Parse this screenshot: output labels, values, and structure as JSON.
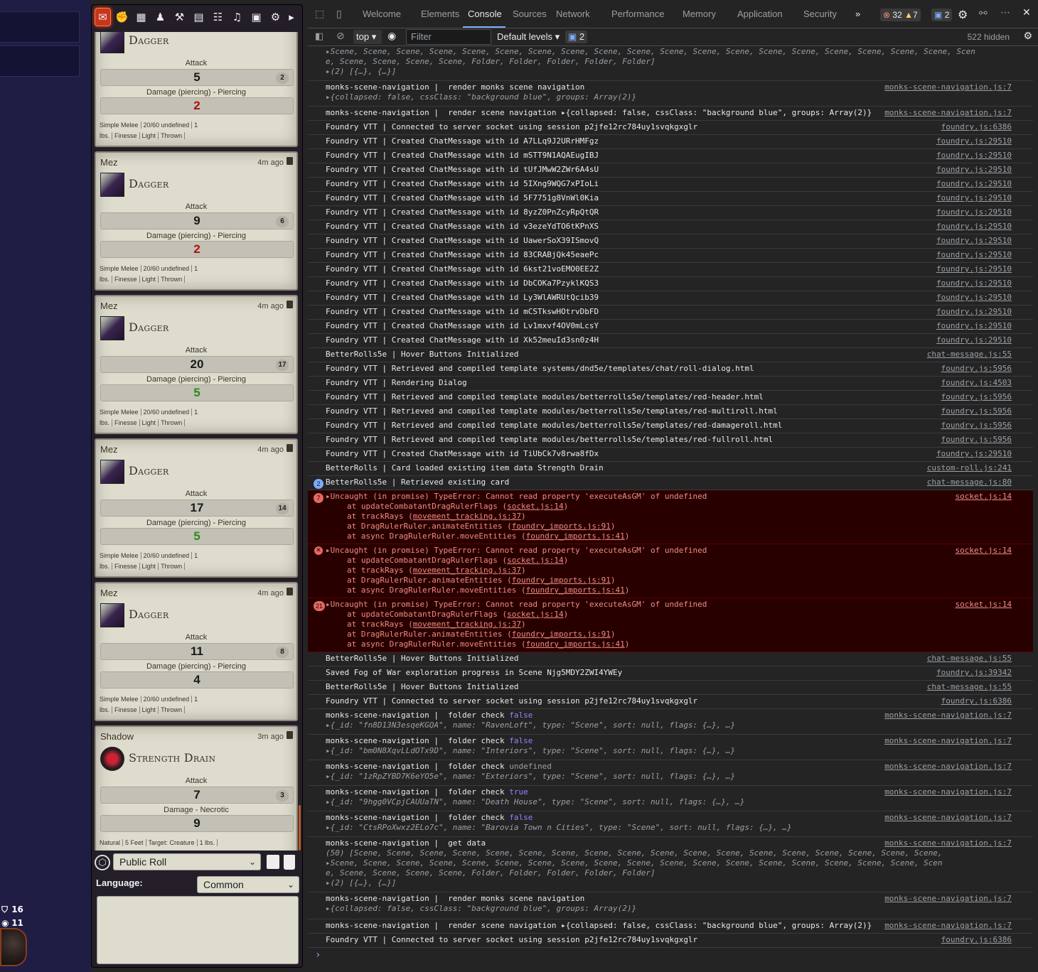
{
  "game": {
    "token_stats": [
      {
        "icon": "shield-icon",
        "value": "16"
      },
      {
        "icon": "eye-icon",
        "value": "11"
      }
    ]
  },
  "sidebar": {
    "tabs": [
      "chat-icon",
      "combat-icon",
      "scenes-icon",
      "actors-icon",
      "items-icon",
      "journal-icon",
      "tables-icon",
      "playlists-icon",
      "compendium-icon",
      "settings-icon",
      "collapse-icon"
    ],
    "cards": [
      {
        "speaker": "",
        "time": "",
        "item": "Dagger",
        "attack_label": "Attack",
        "attack": "5",
        "attack_nat": "2",
        "damage_label": "Damage (piercing) - Piercing",
        "damage": "2",
        "damage_style": "crit-fail",
        "props": [
          "Simple Melee",
          "20/60 undefined",
          "1 lbs.",
          "Finesse",
          "Light",
          "Thrown"
        ]
      },
      {
        "speaker": "Mez",
        "time": "4m ago",
        "item": "Dagger",
        "attack_label": "Attack",
        "attack": "9",
        "attack_nat": "6",
        "damage_label": "Damage (piercing) - Piercing",
        "damage": "2",
        "damage_style": "crit-fail",
        "props": [
          "Simple Melee",
          "20/60 undefined",
          "1 lbs.",
          "Finesse",
          "Light",
          "Thrown"
        ]
      },
      {
        "speaker": "Mez",
        "time": "4m ago",
        "item": "Dagger",
        "attack_label": "Attack",
        "attack": "20",
        "attack_nat": "17",
        "damage_label": "Damage (piercing) - Piercing",
        "damage": "5",
        "damage_style": "success",
        "props": [
          "Simple Melee",
          "20/60 undefined",
          "1 lbs.",
          "Finesse",
          "Light",
          "Thrown"
        ]
      },
      {
        "speaker": "Mez",
        "time": "4m ago",
        "item": "Dagger",
        "attack_label": "Attack",
        "attack": "17",
        "attack_nat": "14",
        "damage_label": "Damage (piercing) - Piercing",
        "damage": "5",
        "damage_style": "success",
        "props": [
          "Simple Melee",
          "20/60 undefined",
          "1 lbs.",
          "Finesse",
          "Light",
          "Thrown"
        ]
      },
      {
        "speaker": "Mez",
        "time": "4m ago",
        "item": "Dagger",
        "attack_label": "Attack",
        "attack": "11",
        "attack_nat": "8",
        "damage_label": "Damage (piercing) - Piercing",
        "damage": "4",
        "damage_style": "",
        "props": [
          "Simple Melee",
          "20/60 undefined",
          "1 lbs.",
          "Finesse",
          "Light",
          "Thrown"
        ]
      },
      {
        "speaker": "Shadow",
        "time": "3m ago",
        "item": "Strength Drain",
        "attack_label": "Attack",
        "attack": "7",
        "attack_nat": "3",
        "damage_label": "Damage - Necrotic",
        "damage": "9",
        "damage_style": "",
        "props": [
          "Natural",
          "5 Feet",
          "Target: Creature",
          "1 lbs."
        ]
      }
    ],
    "roll_mode": "Public Roll",
    "language_label": "Language:",
    "language": "Common"
  },
  "devtools": {
    "tabs": [
      "Welcome",
      "Elements",
      "Console",
      "Sources",
      "Network",
      "Performance",
      "Memory",
      "Application",
      "Security"
    ],
    "active_tab": "Console",
    "more": "»",
    "error_count": "32",
    "warning_count": "7",
    "message_count": "2",
    "context": "top",
    "filter_placeholder": "Filter",
    "levels": "Default levels ▾",
    "issues": "2",
    "hidden": "522 hidden",
    "prompt": "›",
    "lines": [
      {
        "h": 48,
        "kind": "sub-only",
        "sub": [
          "▸Scene, Scene, Scene, Scene, Scene, Scene, Scene, Scene, Scene, Scene, Scene, Scene, Scene, Scene, Scene, Scene, Scene, Scene, Scene, Scen",
          "e, Scene, Scene, Scene, Scene, Folder, Folder, Folder, Folder, Folder]",
          "▸(2) [{…}, {…}]"
        ]
      },
      {
        "h": 36,
        "text": "monks-scene-navigation |  render monks scene navigation",
        "src": "monks-scene-navigation.js:7",
        "sub": [
          "▸{collapsed: false, cssClass: \"background blue\", groups: Array(2)}"
        ]
      },
      {
        "h": 20,
        "text": "monks-scene-navigation |  render scene navigation ▸{collapsed: false, cssClass: \"background blue\", groups: Array(2)}",
        "src": "monks-scene-navigation.js:7"
      },
      {
        "h": 20,
        "text": "Foundry VTT | Connected to server socket using session p2jfe12rc784uy1svqkgxglr",
        "src": "foundry.js:6386"
      },
      {
        "h": 20,
        "text": "Foundry VTT | Created ChatMessage with id A7LLq9J2URrHMFgz",
        "src": "foundry.js:29510"
      },
      {
        "h": 20,
        "text": "Foundry VTT | Created ChatMessage with id mSTT9N1AQAEugIBJ",
        "src": "foundry.js:29510"
      },
      {
        "h": 20,
        "text": "Foundry VTT | Created ChatMessage with id tUfJMwW2ZWr6A4sU",
        "src": "foundry.js:29510"
      },
      {
        "h": 20,
        "text": "Foundry VTT | Created ChatMessage with id 5IXng9WQG7xPIoLi",
        "src": "foundry.js:29510"
      },
      {
        "h": 20,
        "text": "Foundry VTT | Created ChatMessage with id 5F7751g8VnWl0Kia",
        "src": "foundry.js:29510"
      },
      {
        "h": 20,
        "text": "Foundry VTT | Created ChatMessage with id 8yzZ0PnZcyRpQtQR",
        "src": "foundry.js:29510"
      },
      {
        "h": 20,
        "text": "Foundry VTT | Created ChatMessage with id v3ezeYdTO6tKPnXS",
        "src": "foundry.js:29510"
      },
      {
        "h": 20,
        "text": "Foundry VTT | Created ChatMessage with id UawerSoX39ISmovQ",
        "src": "foundry.js:29510"
      },
      {
        "h": 20,
        "text": "Foundry VTT | Created ChatMessage with id 83CRABjQk45eaePc",
        "src": "foundry.js:29510"
      },
      {
        "h": 20,
        "text": "Foundry VTT | Created ChatMessage with id 6kst21voEMO0EE2Z",
        "src": "foundry.js:29510"
      },
      {
        "h": 20,
        "text": "Foundry VTT | Created ChatMessage with id DbCOKa7PzyklKQS3",
        "src": "foundry.js:29510"
      },
      {
        "h": 20,
        "text": "Foundry VTT | Created ChatMessage with id Ly3WlAWRUtQcib39",
        "src": "foundry.js:29510"
      },
      {
        "h": 20,
        "text": "Foundry VTT | Created ChatMessage with id mCSTkswHOtrvDbFD",
        "src": "foundry.js:29510"
      },
      {
        "h": 20,
        "text": "Foundry VTT | Created ChatMessage with id Lv1mxvf4OV0mLcsY",
        "src": "foundry.js:29510"
      },
      {
        "h": 20,
        "text": "Foundry VTT | Created ChatMessage with id Xk52meuId3sn0z4H",
        "src": "foundry.js:29510"
      },
      {
        "h": 20,
        "text": "BetterRolls5e | Hover Buttons Initialized",
        "src": "chat-message.js:55"
      },
      {
        "h": 20,
        "text": "Foundry VTT | Retrieved and compiled template systems/dnd5e/templates/chat/roll-dialog.html",
        "src": "foundry.js:5956"
      },
      {
        "h": 20,
        "text": "Foundry VTT | Rendering Dialog",
        "src": "foundry.js:4503"
      },
      {
        "h": 20,
        "text": "Foundry VTT | Retrieved and compiled template modules/betterrolls5e/templates/red-header.html",
        "src": "foundry.js:5956"
      },
      {
        "h": 20,
        "text": "Foundry VTT | Retrieved and compiled template modules/betterrolls5e/templates/red-multiroll.html",
        "src": "foundry.js:5956"
      },
      {
        "h": 20,
        "text": "Foundry VTT | Retrieved and compiled template modules/betterrolls5e/templates/red-damageroll.html",
        "src": "foundry.js:5956"
      },
      {
        "h": 20,
        "text": "Foundry VTT | Retrieved and compiled template modules/betterrolls5e/templates/red-fullroll.html",
        "src": "foundry.js:5956"
      },
      {
        "h": 20,
        "text": "Foundry VTT | Created ChatMessage with id TiUbCk7v8rwa8fDx",
        "src": "foundry.js:29510"
      },
      {
        "h": 20,
        "text": "BetterRolls | Card loaded existing item data Strength Drain",
        "src": "custom-roll.js:241"
      },
      {
        "h": 20,
        "text": "BetterRolls5e | Retrieved existing card",
        "src": "chat-message.js:80",
        "counter": "2",
        "counter_style": "blue"
      },
      {
        "h": 76,
        "kind": "error",
        "counter": "7",
        "text": "▸Uncaught (in promise) TypeError: Cannot read property 'executeAsGM' of undefined",
        "src": "socket.js:14",
        "stack": [
          [
            "at updateCombatantDragRulerFlags (",
            "socket.js:14",
            ")"
          ],
          [
            "at trackRays (",
            "movement_tracking.js:37",
            ")"
          ],
          [
            "at DragRulerRuler.animateEntities (",
            "foundry_imports.js:91",
            ")"
          ],
          [
            "at async DragRulerRuler.moveEntities (",
            "foundry_imports.js:41",
            ")"
          ]
        ]
      },
      {
        "h": 76,
        "kind": "error",
        "counter": "",
        "text": "▸Uncaught (in promise) TypeError: Cannot read property 'executeAsGM' of undefined",
        "src": "socket.js:14",
        "stack": [
          [
            "at updateCombatantDragRulerFlags (",
            "socket.js:14",
            ")"
          ],
          [
            "at trackRays (",
            "movement_tracking.js:37",
            ")"
          ],
          [
            "at DragRulerRuler.animateEntities (",
            "foundry_imports.js:91",
            ")"
          ],
          [
            "at async DragRulerRuler.moveEntities (",
            "foundry_imports.js:41",
            ")"
          ]
        ]
      },
      {
        "h": 76,
        "kind": "error",
        "counter": "21",
        "text": "▸Uncaught (in promise) TypeError: Cannot read property 'executeAsGM' of undefined",
        "src": "socket.js:14",
        "stack": [
          [
            "at updateCombatantDragRulerFlags (",
            "socket.js:14",
            ")"
          ],
          [
            "at trackRays (",
            "movement_tracking.js:37",
            ")"
          ],
          [
            "at DragRulerRuler.animateEntities (",
            "foundry_imports.js:91",
            ")"
          ],
          [
            "at async DragRulerRuler.moveEntities (",
            "foundry_imports.js:41",
            ")"
          ]
        ]
      },
      {
        "h": 20,
        "text": "BetterRolls5e | Hover Buttons Initialized",
        "src": "chat-message.js:55"
      },
      {
        "h": 20,
        "text": "Saved Fog of War exploration progress in Scene Njg5MDY2ZWI4YWEy",
        "src": "foundry.js:39342"
      },
      {
        "h": 20,
        "text": "BetterRolls5e | Hover Buttons Initialized",
        "src": "chat-message.js:55"
      },
      {
        "h": 20,
        "text": "Foundry VTT | Connected to server socket using session p2jfe12rc784uy1svqkgxglr",
        "src": "foundry.js:6386"
      },
      {
        "h": 36,
        "text": "monks-scene-navigation |  folder check ",
        "val": "false",
        "src": "monks-scene-navigation.js:7",
        "sub": [
          "▸{_id: \"fn8D13N3esqeKGQA\", name: \"RavenLoft\", type: \"Scene\", sort: null, flags: {…}, …}"
        ]
      },
      {
        "h": 36,
        "text": "monks-scene-navigation |  folder check ",
        "val": "false",
        "src": "monks-scene-navigation.js:7",
        "sub": [
          "▸{_id: \"bm0N8XqvLLdOTx9D\", name: \"Interiors\", type: \"Scene\", sort: null, flags: {…}, …}"
        ]
      },
      {
        "h": 36,
        "text": "monks-scene-navigation |  folder check ",
        "val": "undefined",
        "src": "monks-scene-navigation.js:7",
        "sub": [
          "▸{_id: \"1zRpZYBD7K6eYO5e\", name: \"Exteriors\", type: \"Scene\", sort: null, flags: {…}, …}"
        ]
      },
      {
        "h": 36,
        "text": "monks-scene-navigation |  folder check ",
        "val": "true",
        "src": "monks-scene-navigation.js:7",
        "sub": [
          "▸{_id: \"9hgg0VCpjCAUUaTN\", name: \"Death House\", type: \"Scene\", sort: null, flags: {…}, …}"
        ]
      },
      {
        "h": 36,
        "text": "monks-scene-navigation |  folder check ",
        "val": "false",
        "src": "monks-scene-navigation.js:7",
        "sub": [
          "▸{_id: \"CtsRPoXwxz2ELo7c\", name: \"Barovia Town n Cities\", type: \"Scene\", sort: null, flags: {…}, …}"
        ]
      },
      {
        "h": 78,
        "text": "monks-scene-navigation |  get data",
        "src": "monks-scene-navigation.js:7",
        "sub": [
          "(50) [Scene, Scene, Scene, Scene, Scene, Scene, Scene, Scene, Scene, Scene, Scene, Scene, Scene, Scene, Scene, Scene, Scene, Scene,",
          "▸Scene, Scene, Scene, Scene, Scene, Scene, Scene, Scene, Scene, Scene, Scene, Scene, Scene, Scene, Scene, Scene, Scene, Scene, Scen",
          "e, Scene, Scene, Scene, Scene, Folder, Folder, Folder, Folder, Folder]",
          "▸(2) [{…}, {…}]"
        ]
      },
      {
        "h": 38,
        "text": "monks-scene-navigation |  render monks scene navigation",
        "src": "monks-scene-navigation.js:7",
        "sub": [
          "▸{collapsed: false, cssClass: \"background blue\", groups: Array(2)}"
        ]
      },
      {
        "h": 20,
        "text": "monks-scene-navigation |  render scene navigation ▸{collapsed: false, cssClass: \"background blue\", groups: Array(2)}",
        "src": "monks-scene-navigation.js:7"
      },
      {
        "h": 20,
        "text": "Foundry VTT | Connected to server socket using session p2jfe12rc784uy1svqkgxglr",
        "src": "foundry.js:6386"
      }
    ]
  }
}
